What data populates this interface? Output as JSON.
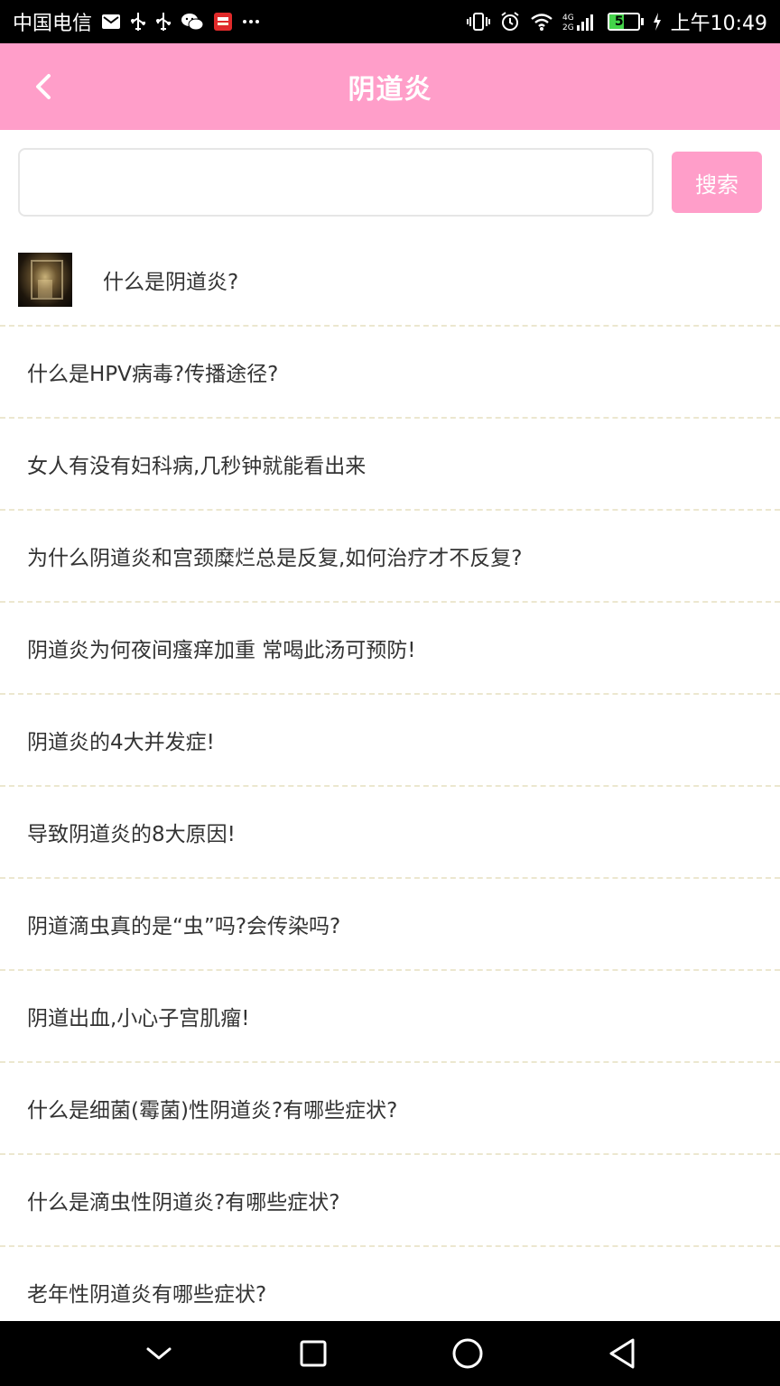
{
  "status_bar": {
    "carrier": "中国电信",
    "battery_level": "52",
    "battery_fraction": 0.52,
    "time": "上午10:49",
    "icons": [
      "mail-icon",
      "usb-icon",
      "usb-icon",
      "wechat-icon",
      "app-notification-icon",
      "more-dots-icon",
      "vibrate-icon",
      "alarm-icon",
      "wifi-icon",
      "signal-4g-icon",
      "battery-icon",
      "charging-icon"
    ]
  },
  "header": {
    "title": "阴道炎",
    "back_icon": "chevron-left-icon"
  },
  "search": {
    "placeholder": "",
    "value": "",
    "button_label": "搜索"
  },
  "articles": [
    {
      "title": "什么是阴道炎?"
    },
    {
      "title": "什么是HPV病毒?传播途径?"
    },
    {
      "title": "女人有没有妇科病,几秒钟就能看出来"
    },
    {
      "title": "为什么阴道炎和宫颈糜烂总是反复,如何治疗才不反复?"
    },
    {
      "title": "阴道炎为何夜间瘙痒加重 常喝此汤可预防!"
    },
    {
      "title": "阴道炎的4大并发症!"
    },
    {
      "title": "导致阴道炎的8大原因!"
    },
    {
      "title": "阴道滴虫真的是“虫”吗?会传染吗?"
    },
    {
      "title": "阴道出血,小心子宫肌瘤!"
    },
    {
      "title": "什么是细菌(霉菌)性阴道炎?有哪些症状?"
    },
    {
      "title": "什么是滴虫性阴道炎?有哪些症状?"
    },
    {
      "title": "老年性阴道炎有哪些症状?"
    }
  ],
  "colors": {
    "accent": "#ff9ec9",
    "divider": "#ece7cf",
    "battery_green": "#44d44a"
  },
  "nav": {
    "back_icon": "nav-back-icon",
    "home_icon": "nav-home-icon",
    "recents_icon": "nav-recents-icon",
    "collapse_icon": "nav-collapse-icon"
  }
}
